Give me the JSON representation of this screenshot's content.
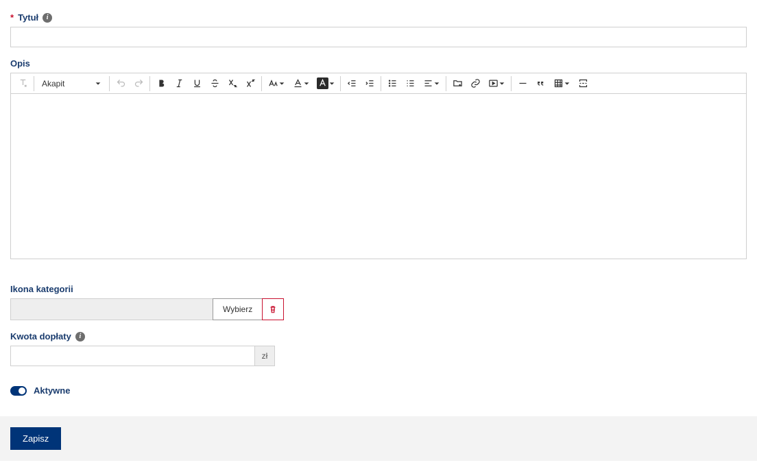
{
  "fields": {
    "title": {
      "label": "Tytuł",
      "value": ""
    },
    "description": {
      "label": "Opis",
      "value": ""
    },
    "category_icon": {
      "label": "Ikona kategorii",
      "choose_btn": "Wybierz"
    },
    "amount": {
      "label": "Kwota dopłaty",
      "value": "",
      "suffix": "zł"
    },
    "active": {
      "label": "Aktywne",
      "checked": true
    }
  },
  "editor": {
    "format_dropdown": "Akapit"
  },
  "footer": {
    "save_btn": "Zapisz"
  }
}
